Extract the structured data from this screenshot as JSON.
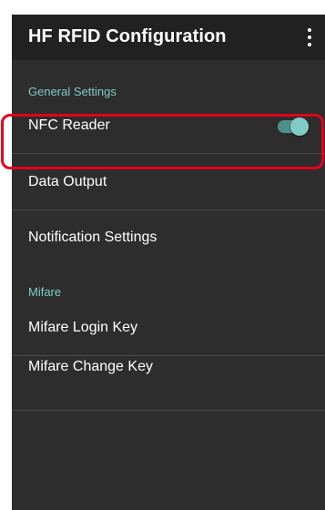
{
  "app_bar": {
    "title": "HF RFID Configuration",
    "overflow_icon": "more-vert-icon"
  },
  "sections": {
    "general": {
      "header": "General Settings",
      "nfc_reader": {
        "label": "NFC Reader",
        "toggle_on": true
      },
      "data_output": {
        "label": "Data Output"
      },
      "notification_settings": {
        "label": "Notification Settings"
      }
    },
    "mifare": {
      "header": "Mifare",
      "login_key": {
        "label": "Mifare Login Key"
      },
      "change_key": {
        "label": "Mifare Change Key"
      }
    }
  },
  "colors": {
    "app_bar": "#212121",
    "background": "#2d2d2d",
    "accent": "#80cbc4",
    "highlight": "#e3001b"
  }
}
